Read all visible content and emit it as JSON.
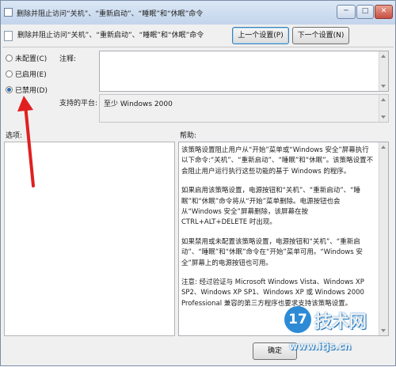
{
  "window": {
    "title": "删除并阻止访问“关机”、“重新启动”、“睡眠”和“休眠”命令",
    "minimize_glyph": "─",
    "maximize_glyph": "□",
    "close_glyph": "✕"
  },
  "header": {
    "policy_title": "删除并阻止访问“关机”、“重新启动”、“睡眠”和“休眠”命令",
    "prev_button": "上一个设置(P)",
    "next_button": "下一个设置(N)"
  },
  "options": {
    "not_configured": "未配置(C)",
    "enabled": "已启用(E)",
    "disabled": "已禁用(D)",
    "selected": "disabled"
  },
  "fields": {
    "comment_label": "注释:",
    "comment_value": "",
    "platform_label": "支持的平台:",
    "platform_value": "至少 Windows 2000"
  },
  "sections": {
    "options_label": "选项:",
    "help_label": "帮助:"
  },
  "help": {
    "p1": "该策略设置阻止用户从“开始”菜单或“Windows 安全”屏幕执行以下命令:“关机”、“重新启动”、“睡眠”和“休眠”。该策略设置不会阻止用户运行执行这些功能的基于 Windows 的程序。",
    "p2": "如果启用该策略设置，电源按钮和“关机”、“重新启动”、“睡眠”和“休眠”命令将从“开始”菜单删除。电源按钮也会从“Windows 安全”屏幕删除，该屏幕在按 CTRL+ALT+DELETE 时出现。",
    "p3": "如果禁用或未配置该策略设置，电源按钮和“关机”、“重新启动”、“睡眠”和“休眠”命令在“开始”菜单可用。“Windows 安全”屏幕上的电源按钮也可用。",
    "p4": "注意: 经过验证与 Microsoft Windows Vista、Windows XP SP2、Windows XP SP1、Windows XP 或 Windows 2000 Professional 兼容的第三方程序也要求支持该策略设置。"
  },
  "footer": {
    "ok_button": "确定"
  },
  "watermark": {
    "circle_text": "17",
    "name": "技术网",
    "url": "www.itjs.cn"
  },
  "colors": {
    "annotation_arrow": "#e02020",
    "watermark_blue": "#2d8bd6"
  }
}
